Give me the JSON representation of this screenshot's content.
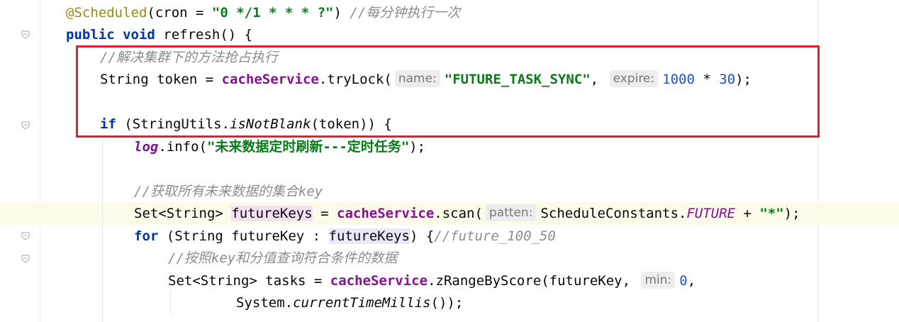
{
  "editor": {
    "lines": [
      {
        "indent": 93,
        "parts": [
          {
            "t": "@Scheduled",
            "c": "ann"
          },
          {
            "t": "(cron = "
          },
          {
            "t": "\"0 */1 * * * ?\"",
            "c": "str"
          },
          {
            "t": ") "
          },
          {
            "t": "//每分钟执行一次",
            "c": "cmt"
          }
        ]
      },
      {
        "indent": 93,
        "parts": [
          {
            "t": "public void ",
            "c": "kw"
          },
          {
            "t": "refresh() {"
          }
        ]
      },
      {
        "indent": 141,
        "parts": [
          {
            "t": "//解决集群下的方法抢占执行",
            "c": "cmt"
          }
        ]
      },
      {
        "indent": 141,
        "parts": [
          {
            "t": "String token = "
          },
          {
            "t": "cacheService",
            "c": "field"
          },
          {
            "t": ".tryLock("
          },
          {
            "hint": "name:"
          },
          {
            "t": "\"FUTURE_TASK_SYNC\"",
            "c": "str"
          },
          {
            "t": ", "
          },
          {
            "hint": "expire:"
          },
          {
            "t": "1000",
            "c": "num"
          },
          {
            "t": " * "
          },
          {
            "t": "30",
            "c": "num"
          },
          {
            "t": ");"
          }
        ]
      },
      {
        "indent": 141,
        "parts": []
      },
      {
        "indent": 141,
        "parts": [
          {
            "t": "if ",
            "c": "kw"
          },
          {
            "t": "(StringUtils."
          },
          {
            "t": "isNotBlank",
            "c": "italic"
          },
          {
            "t": "(token)) {"
          }
        ]
      },
      {
        "indent": 189,
        "parts": [
          {
            "t": "log",
            "c": "fieldi"
          },
          {
            "t": ".info("
          },
          {
            "t": "\"未来数据定时刷新---定时任务\"",
            "c": "str"
          },
          {
            "t": ");"
          }
        ]
      },
      {
        "indent": 189,
        "parts": []
      },
      {
        "indent": 189,
        "parts": [
          {
            "t": "//获取所有未来数据的集合key",
            "c": "cmt"
          }
        ]
      },
      {
        "indent": 189,
        "highlight": true,
        "parts": [
          {
            "t": "Set<String> "
          },
          {
            "t": "futureKeys",
            "c": "var-hl"
          },
          {
            "t": " = "
          },
          {
            "t": "cacheService",
            "c": "field"
          },
          {
            "t": ".scan("
          },
          {
            "hint": "patten:"
          },
          {
            "t": "ScheduleConstants."
          },
          {
            "t": "FUTURE",
            "c": "const"
          },
          {
            "t": " + "
          },
          {
            "t": "\"*\"",
            "c": "str"
          },
          {
            "t": ");"
          }
        ]
      },
      {
        "indent": 189,
        "parts": [
          {
            "t": "for ",
            "c": "kw"
          },
          {
            "t": "(String futureKey : "
          },
          {
            "t": "futureKeys",
            "c": "var-hl2"
          },
          {
            "t": ") {"
          },
          {
            "t": "//future_100_50",
            "c": "cmt"
          }
        ]
      },
      {
        "indent": 237,
        "parts": [
          {
            "t": "//按照key和分值查询符合条件的数据",
            "c": "cmt"
          }
        ]
      },
      {
        "indent": 237,
        "parts": [
          {
            "t": "Set<String> tasks = "
          },
          {
            "t": "cacheService",
            "c": "field"
          },
          {
            "t": ".zRangeByScore(futureKey, "
          },
          {
            "hint": "min:"
          },
          {
            "t": "0",
            "c": "num"
          },
          {
            "t": ","
          }
        ]
      },
      {
        "indent": 333,
        "parts": [
          {
            "t": "System."
          },
          {
            "t": "currentTimeMillis",
            "c": "italic"
          },
          {
            "t": "());"
          }
        ]
      }
    ]
  }
}
